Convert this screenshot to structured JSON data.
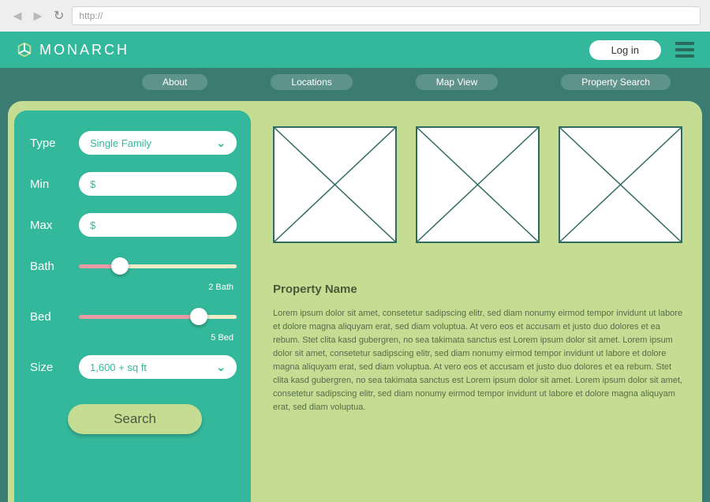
{
  "browser": {
    "url": "http://"
  },
  "header": {
    "brand": "MONARCH",
    "login": "Log in"
  },
  "nav": {
    "items": [
      "About",
      "Locations",
      "Map View",
      "Property Search"
    ]
  },
  "filters": {
    "type": {
      "label": "Type",
      "value": "Single Family"
    },
    "min": {
      "label": "Min",
      "symbol": "$"
    },
    "max": {
      "label": "Max",
      "symbol": "$"
    },
    "bath": {
      "label": "Bath",
      "caption": "2 Bath",
      "percent": 26
    },
    "bed": {
      "label": "Bed",
      "caption": "5 Bed",
      "percent": 76
    },
    "size": {
      "label": "Size",
      "value": "1,600 + sq ft"
    },
    "search": "Search"
  },
  "property": {
    "title": "Property Name",
    "desc": "Lorem ipsum dolor sit amet, consetetur sadipscing elitr, sed diam nonumy eirmod tempor invidunt ut labore et dolore magna aliquyam erat, sed diam voluptua. At vero eos et accusam et justo duo dolores et ea rebum. Stet clita kasd gubergren, no sea takimata sanctus est Lorem ipsum dolor sit amet. Lorem ipsum dolor sit amet, consetetur sadipscing elitr, sed diam nonumy eirmod tempor invidunt ut labore et dolore magna aliquyam erat, sed diam voluptua. At vero eos et accusam et justo duo dolores et ea rebum. Stet clita kasd gubergren, no sea takimata sanctus est Lorem ipsum dolor sit amet. Lorem ipsum dolor sit amet, consetetur sadipscing elitr, sed diam nonumy eirmod tempor invidunt ut labore et dolore magna aliquyam erat, sed diam voluptua."
  }
}
